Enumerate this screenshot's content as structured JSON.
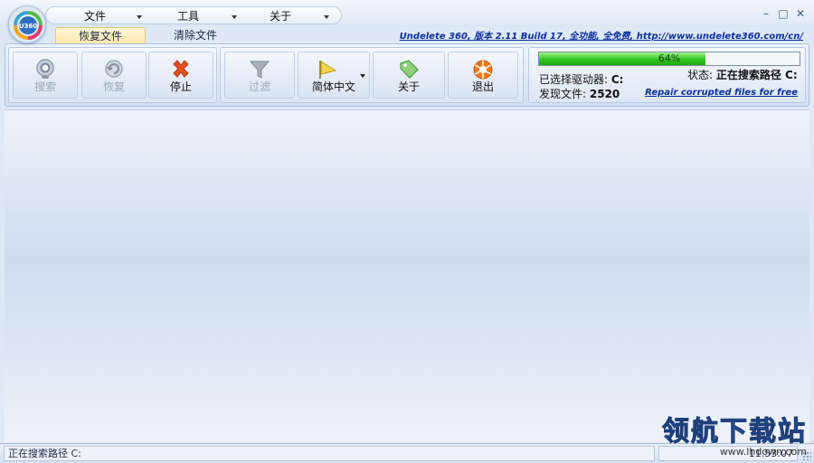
{
  "menubar": {
    "items": [
      {
        "label": "文件"
      },
      {
        "label": "工具"
      },
      {
        "label": "关于"
      }
    ]
  },
  "window_controls": {
    "minimize": "–",
    "maximize": "□",
    "close": "✕"
  },
  "tabs": [
    {
      "label": "恢复文件",
      "active": true
    },
    {
      "label": "清除文件",
      "active": false
    }
  ],
  "about_link": "Undelete 360, 版本 2.11 Build 17, 全功能, 全免费, http://www.undelete360.com/cn/",
  "toolbar": {
    "search_label": "搜索",
    "recover_label": "恢复",
    "stop_label": "停止",
    "filter_label": "过滤",
    "language_label": "简体中文",
    "about_label": "关于",
    "exit_label": "退出"
  },
  "status_panel": {
    "progress_percent": 64,
    "progress_text": "64%",
    "selected_drive_label": "已选择驱动器:",
    "selected_drive_value": "C:",
    "status_label": "状态:",
    "status_value": "正在搜索路径 C:",
    "found_files_label": "发现文件:",
    "found_files_value": "2520",
    "repair_link": "Repair corrupted files for free"
  },
  "statusbar": {
    "left_text": "正在搜索路径  C:",
    "time_text": "11:53:07"
  },
  "watermark": {
    "title": "领航下载站",
    "url": "www.lhdown.com"
  },
  "colors": {
    "accent": "#0a2e9c",
    "progress": "#2fc61e",
    "stop_icon": "#e8501d",
    "exit_icon": "#f07b1a"
  }
}
